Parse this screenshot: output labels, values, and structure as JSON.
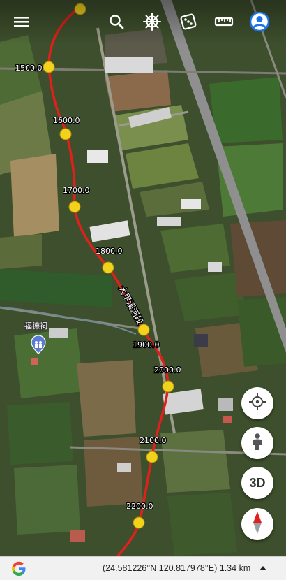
{
  "topbar": {
    "menu_icon": "hamburger-menu-icon",
    "search_icon": "search-icon",
    "ship_wheel_icon": "ship-wheel-icon",
    "dice_icon": "dice-icon",
    "ruler_icon": "ruler-icon",
    "account_icon": "account-circle-icon",
    "accent": "#1a73e8"
  },
  "map": {
    "track_color": "#e0201a",
    "marker_color": "#f2d21b",
    "distance_labels": [
      "1500.0",
      "1600.0",
      "1700.0",
      "1800.0",
      "1900.0",
      "2000.0",
      "2100.0",
      "2200.0"
    ],
    "road_label": "大甲溪河段",
    "poi_label": "福德祠"
  },
  "controls": {
    "locate_icon": "crosshair-locate-icon",
    "person_icon": "street-view-person-icon",
    "three_d_label": "3D",
    "compass_icon": "compass-icon"
  },
  "bottombar": {
    "google_icon": "google-g-icon",
    "coordinates": "(24.581226°N 120.817978°E) 1.34 km",
    "expand_icon": "caret-up-icon"
  }
}
